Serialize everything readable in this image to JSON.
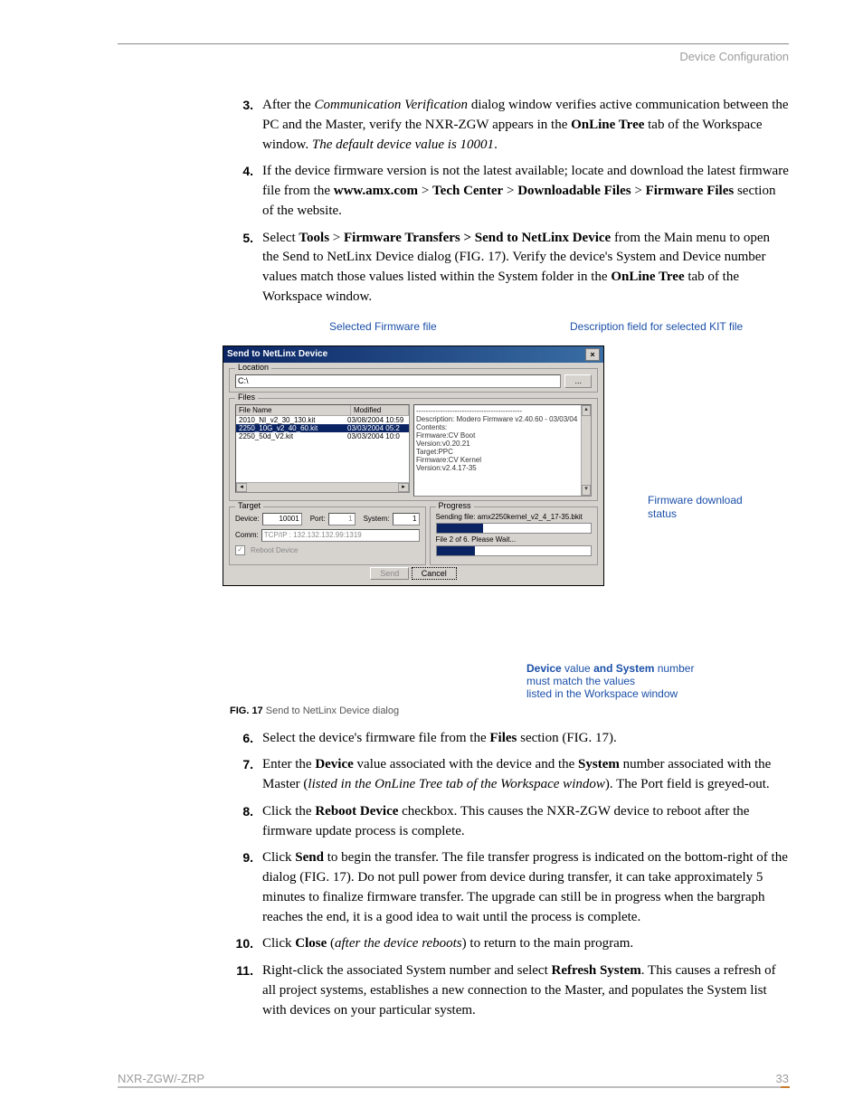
{
  "header": {
    "section": "Device Configuration"
  },
  "steps_a": [
    {
      "n": "3.",
      "html": "After the <span class='it'>Communication Verification</span> dialog window verifies active communication between the PC and the Master, verify the NXR-ZGW appears in the <span class='b'>OnLine Tree</span> tab of the Workspace window. <span class='it'>The default device value is 10001</span>."
    },
    {
      "n": "4.",
      "html": "If the device firmware version is not the latest available; locate and download the latest firmware file from the <span class='b'>www.amx.com</span> &gt; <span class='b'>Tech Center</span> &gt; <span class='b'>Downloadable Files</span> &gt; <span class='b'>Firmware Files</span> section of the website."
    },
    {
      "n": "5.",
      "html": "Select <span class='b'>Tools</span> &gt; <span class='b'>Firmware Transfers &gt; Send to NetLinx Device</span> from the Main menu to open the Send to NetLinx Device dialog (FIG. 17). Verify the device's System and Device number values match those values listed within the System folder in the <span class='b'>OnLine Tree</span> tab of the Workspace window."
    }
  ],
  "annotations": {
    "selected": "Selected Firmware file",
    "descfield": "Description field for selected KIT file",
    "dlstatus": "Firmware download status",
    "match1": "<span class='b'>Device</span> value <span class='b'>and System</span> number",
    "match2": "must match the values",
    "match3": "listed in the Workspace window"
  },
  "dialog": {
    "title": "Send to NetLinx Device",
    "location_label": "Location",
    "location_value": "C:\\",
    "browse": "...",
    "files_label": "Files",
    "col_name": "File Name",
    "col_mod": "Modified",
    "rows": [
      {
        "name": "2010_NI_v2_30_130.kit",
        "mod": "03/08/2004   10:59"
      },
      {
        "name": "2250_10G_v2_40_60.kit",
        "mod": "03/03/2004   05:2",
        "sel": true
      },
      {
        "name": "2250_50d_V2.kit",
        "mod": "03/03/2004   10:0"
      }
    ],
    "desc_lines": [
      "--------------------------------------------",
      "Description: Modero Firmware v2.40.60 - 03/03/04",
      "",
      "Contents:",
      "",
      "Firmware:CV Boot",
      "Version:v0.20.21",
      "Target:PPC",
      "",
      "Firmware:CV Kernel",
      "Version:v2.4.17-35"
    ],
    "target_label": "Target",
    "device_lbl": "Device:",
    "device_val": "10001",
    "port_lbl": "Port:",
    "port_val": "1",
    "system_lbl": "System:",
    "system_val": "1",
    "comm_lbl": "Comm:",
    "comm_val": "TCP/IP : 132.132.132.99:1319",
    "reboot": "Reboot Device",
    "progress_label": "Progress",
    "sending": "Sending file: amx2250kernel_v2_4_17-35.bkit",
    "fileof": "File 2 of 6. Please Wait...",
    "send": "Send",
    "cancel": "Cancel"
  },
  "figcap": {
    "label": "FIG. 17",
    "text": "  Send to NetLinx Device dialog"
  },
  "steps_b": [
    {
      "n": "6.",
      "html": "Select the device's firmware file from the <span class='b'>Files</span> section (FIG. 17)."
    },
    {
      "n": "7.",
      "html": "Enter the <span class='b'>Device</span> value associated with the device and the <span class='b'>System</span> number associated with the Master (<span class='it'>listed in the OnLine Tree tab of the Workspace window</span>). The Port field is greyed-out."
    },
    {
      "n": "8.",
      "html": "Click the <span class='b'>Reboot Device</span> checkbox. This causes the NXR-ZGW device to reboot after the firmware update process is complete."
    },
    {
      "n": "9.",
      "html": "Click <span class='b'>Send</span> to begin the transfer. The file transfer progress is indicated on the bottom-right of the dialog (FIG. 17). Do not pull power from device during transfer, it can take approximately 5 minutes to finalize firmware transfer. The upgrade can still be in progress when the bargraph reaches the end, it is a good idea to wait until the process is complete."
    },
    {
      "n": "10.",
      "html": "Click <span class='b'>Close</span> (<span class='it'>after the device reboots</span>) to return to the main program."
    },
    {
      "n": "11.",
      "html": "Right-click the associated System number and select <span class='b'>Refresh System</span>. This causes a refresh of all project systems, establishes a new connection to the Master, and populates the System list with devices on your particular system."
    }
  ],
  "footer": {
    "left": "NXR-ZGW/-ZRP",
    "page": "33"
  }
}
